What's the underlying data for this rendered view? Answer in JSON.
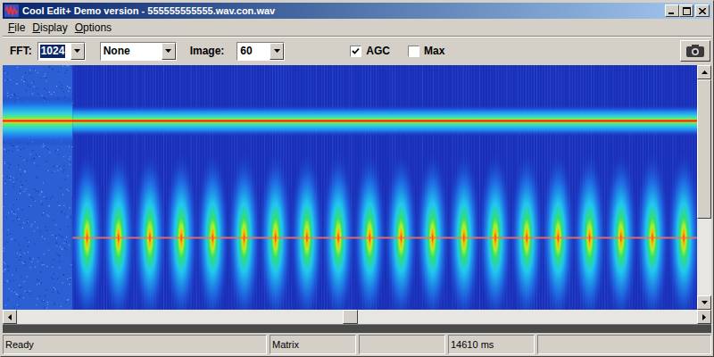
{
  "window": {
    "title": "Cool Edit+ Demo version - 555555555555.wav.con.wav"
  },
  "menu": [
    {
      "label": "File"
    },
    {
      "label": "Display"
    },
    {
      "label": "Options"
    }
  ],
  "toolbar": {
    "fft_label": "FFT:",
    "fft": {
      "value": "1024",
      "selected": true
    },
    "window_function": {
      "value": "None"
    },
    "image_label": "Image:",
    "image": {
      "value": "60"
    },
    "checkboxes": [
      {
        "label": "AGC",
        "checked": true
      },
      {
        "label": "Max",
        "checked": false
      }
    ]
  },
  "scrollbars": {
    "vertical": {
      "level": 0
    },
    "horizontal": {
      "level": 0.49
    }
  },
  "status_bar": {
    "message": "Ready",
    "mode": "Matrix",
    "time": "14610 ms"
  }
}
